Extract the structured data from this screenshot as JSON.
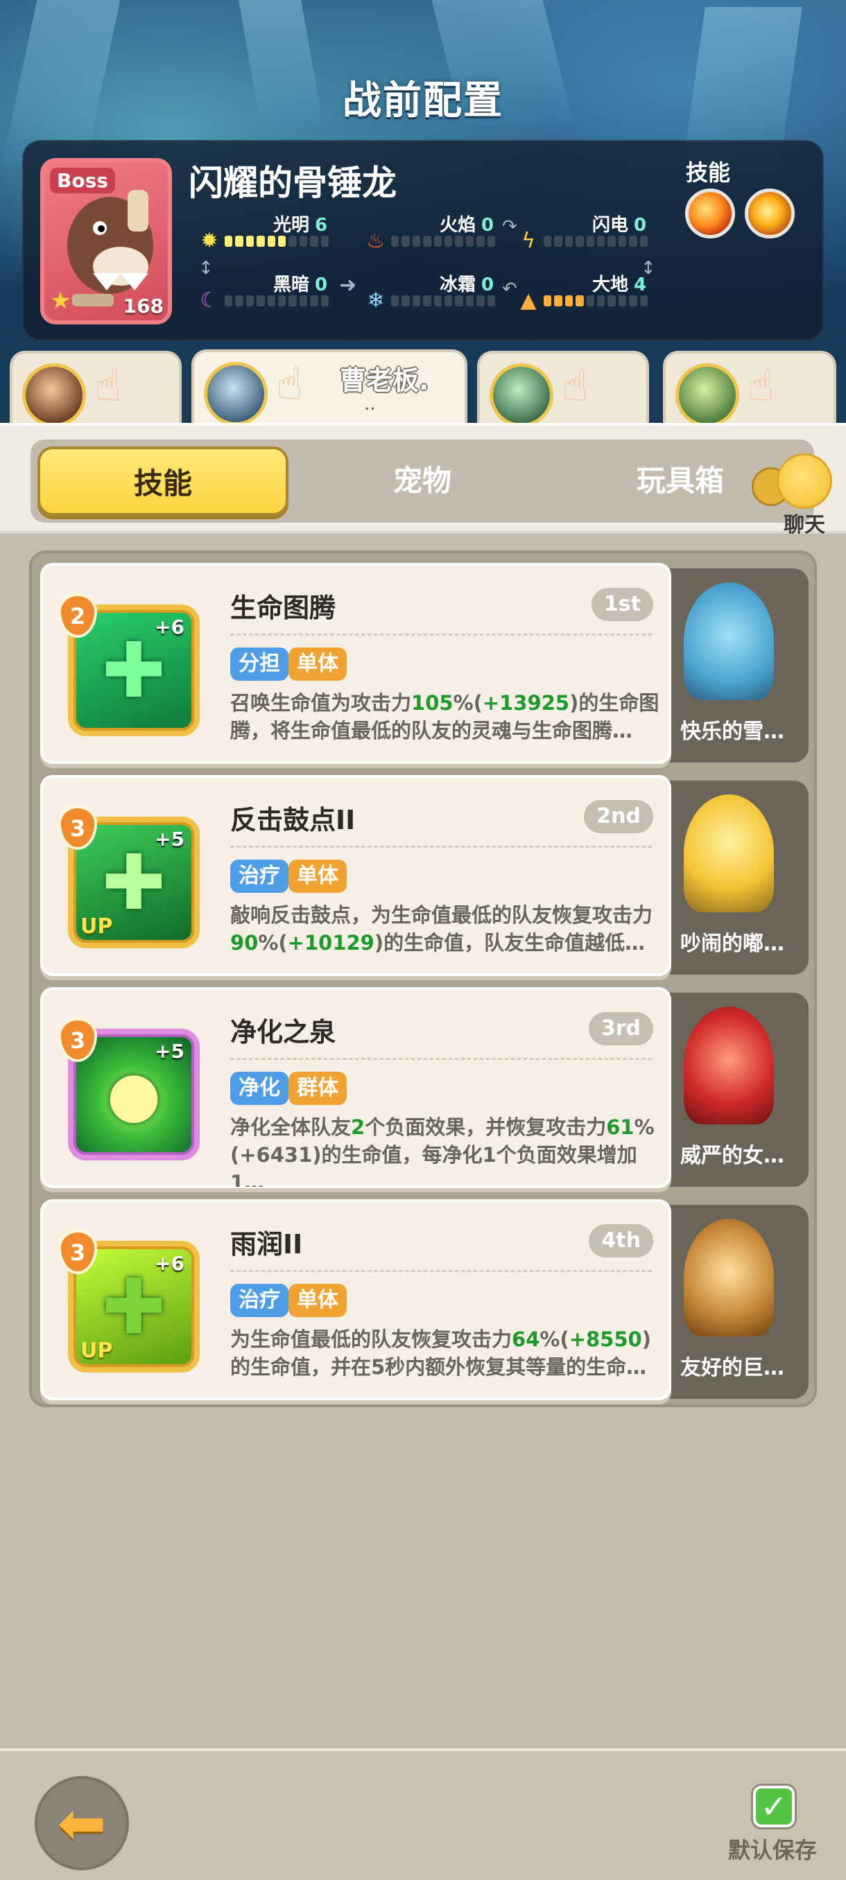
{
  "header": {
    "title": "战前配置"
  },
  "boss": {
    "tag": "Boss",
    "name": "闪耀的骨锤龙",
    "level": "168",
    "skills_label": "技能",
    "elements": [
      {
        "name": "光明",
        "value": "6",
        "level_fraction": 0.6,
        "color": "#fff07a",
        "icon": "sun-icon"
      },
      {
        "name": "火焰",
        "value": "0",
        "level_fraction": 0,
        "color": "#ff5a3a",
        "icon": "flame-icon"
      },
      {
        "name": "闪电",
        "value": "0",
        "level_fraction": 0,
        "color": "#ffd23a",
        "icon": "lightning-icon"
      },
      {
        "name": "黑暗",
        "value": "0",
        "level_fraction": 0,
        "color": "#b45ad6",
        "icon": "moon-icon"
      },
      {
        "name": "冰霜",
        "value": "0",
        "level_fraction": 0,
        "color": "#8fd8ff",
        "icon": "snowflake-icon"
      },
      {
        "name": "大地",
        "value": "4",
        "level_fraction": 0.4,
        "color": "#ffb03a",
        "icon": "mountain-icon"
      }
    ]
  },
  "team_tabs": [
    {
      "owner": "",
      "owner_sub": ""
    },
    {
      "owner": "曹老板.",
      "owner_sub": ".."
    },
    {
      "owner": "",
      "owner_sub": ""
    },
    {
      "owner": "",
      "owner_sub": ""
    }
  ],
  "tabs": {
    "skills": "技能",
    "pets": "宠物",
    "toybox": "玩具箱",
    "active": "技能"
  },
  "chat": {
    "label": "聊天"
  },
  "skills": [
    {
      "level": "2",
      "plus": "+6",
      "title": "生命图腾",
      "rank": "1st",
      "tags": [
        "分担",
        "单体"
      ],
      "desc_pre": "召唤生命值为攻击力",
      "desc_hl1": "105",
      "desc_mid1": "%(",
      "desc_hl2": "+13925",
      "desc_post": ")的生命图腾，将生命值最低的队友的灵魂与生命图腾…",
      "up": "",
      "pet_name": "快乐的雪…"
    },
    {
      "level": "3",
      "plus": "+5",
      "title": "反击鼓点II",
      "rank": "2nd",
      "tags": [
        "治疗",
        "单体"
      ],
      "desc_pre": "敲响反击鼓点，为生命值最低的队友恢复攻击力",
      "desc_hl1": "90",
      "desc_mid1": "%(",
      "desc_hl2": "+10129",
      "desc_post": ")的生命值，队友生命值越低…",
      "up": "UP",
      "pet_name": "吵闹的嘟…"
    },
    {
      "level": "3",
      "plus": "+5",
      "title": "净化之泉",
      "rank": "3rd",
      "tags": [
        "净化",
        "群体"
      ],
      "desc_pre": "净化全体队友",
      "desc_hl1": "2",
      "desc_mid1": "个负面效果，并恢复攻击力",
      "desc_hl2": "61",
      "desc_post": "%(+6431)的生命值，每净化1个负面效果增加1…",
      "up": "",
      "pet_name": "威严的女…"
    },
    {
      "level": "3",
      "plus": "+6",
      "title": "雨润II",
      "rank": "4th",
      "tags": [
        "治疗",
        "单体"
      ],
      "desc_pre": "为生命值最低的队友恢复攻击力",
      "desc_hl1": "64",
      "desc_mid1": "%(",
      "desc_hl2": "+8550",
      "desc_post": ")的生命值，并在5秒内额外恢复其等量的生命…",
      "up": "UP",
      "pet_name": "友好的巨…"
    }
  ],
  "footer": {
    "save_label": "默认保存",
    "save_checked": true
  }
}
